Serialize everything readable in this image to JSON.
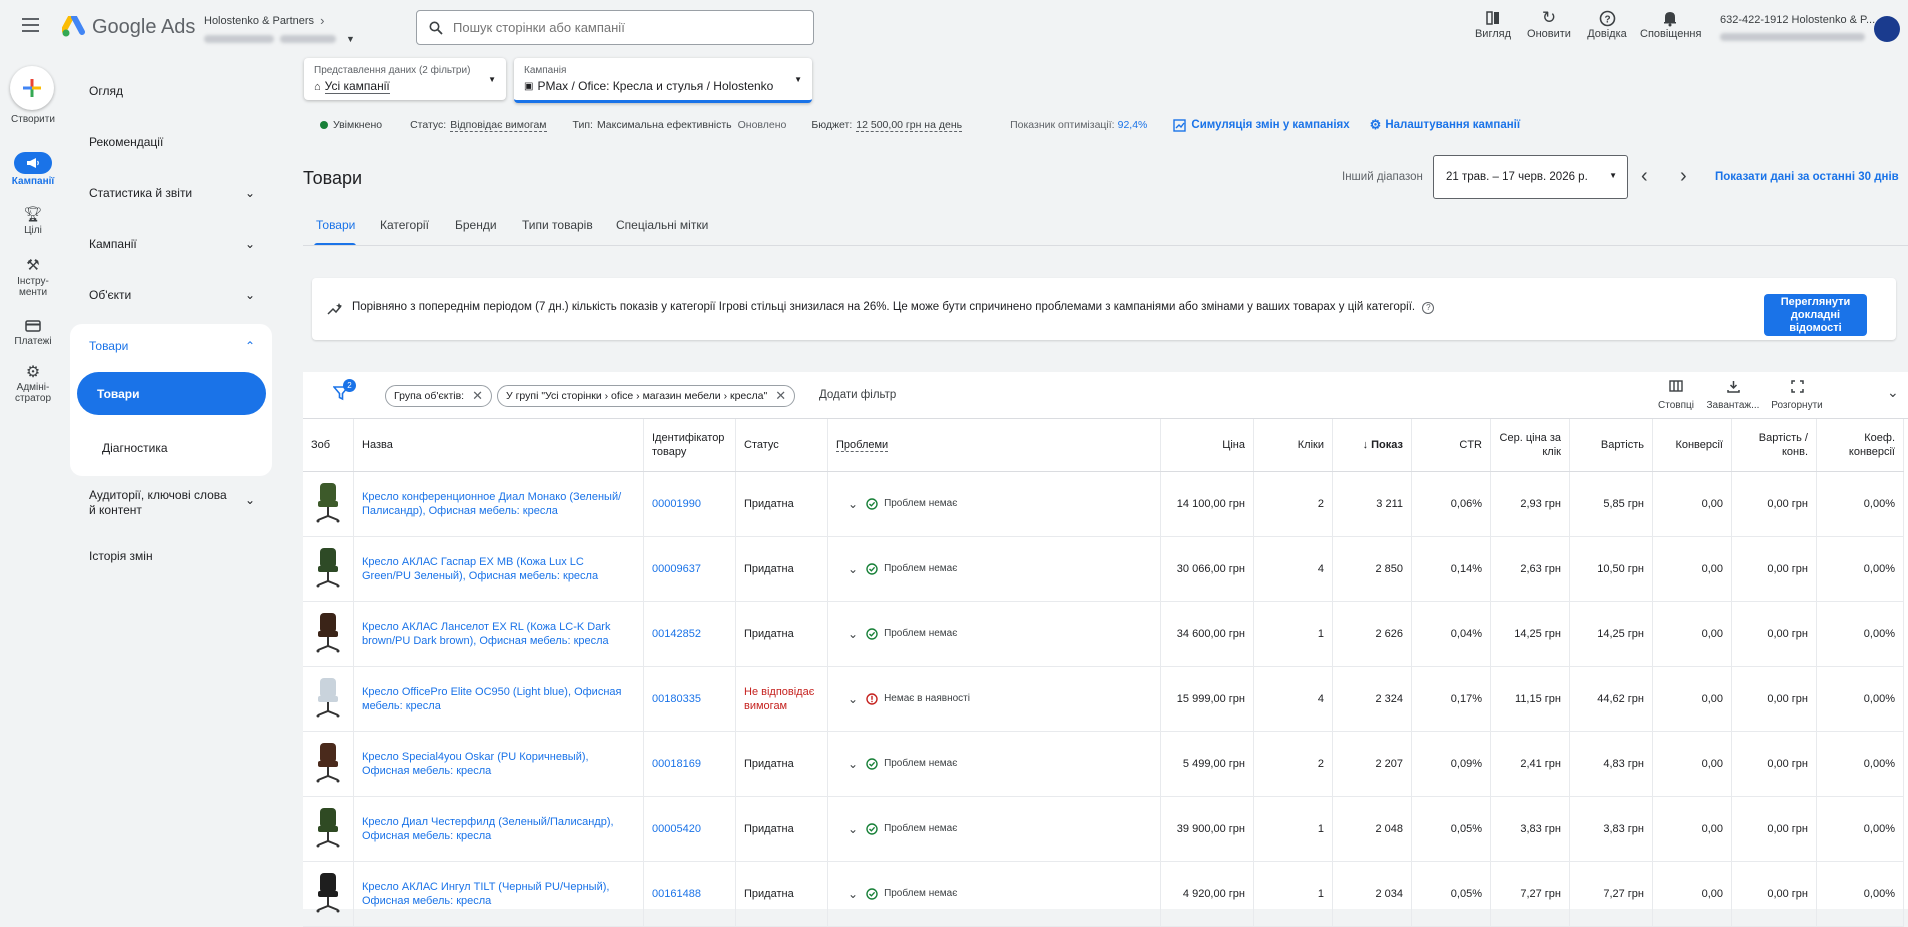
{
  "topbar": {
    "app_name": "Google Ads",
    "account_name": "Holostenko & Partners",
    "search_placeholder": "Пошук сторінки або кампанії",
    "actions": [
      "Вигляд",
      "Оновити",
      "Довідка",
      "Сповіщення"
    ],
    "user_line": "632-422-1912 Holostenko & P..."
  },
  "rail": {
    "items": [
      "Створити",
      "Кампанії",
      "Цілі",
      "Інстру-\nменти",
      "Платежі",
      "Адміні-\nстратор"
    ]
  },
  "sidenav": {
    "items": [
      "Огляд",
      "Рекомендації",
      "Статистика й звіти",
      "Кампанії",
      "Об'єкти",
      "Товари",
      "Товари",
      "Діагностика",
      "Аудиторії, ключові слова й контент",
      "Історія змін"
    ]
  },
  "filters": {
    "view_label": "Представлення даних (2 фільтри)",
    "view_value": "Усі кампанії",
    "campaign_label": "Кампанія",
    "campaign_value": "PMax / Ofice: Кресла и стулья / Holostenko"
  },
  "status_bar": {
    "enabled": "Увімкнено",
    "status_label": "Статус:",
    "status_value": "Відповідає вимогам",
    "type_label": "Тип:",
    "type_value": "Максимальна ефективність",
    "updated": "Оновлено",
    "budget_label": "Бюджет:",
    "budget_value": "12 500,00 грн на день",
    "opt_label": "Показник оптимізації:",
    "opt_value": "92,4%",
    "simulate": "Симуляція змін у кампаніях",
    "settings": "Налаштування кампанії"
  },
  "page": {
    "title": "Товари",
    "range_label": "Інший діапазон",
    "date_range": "21 трав. – 17 черв. 2026 р.",
    "last30": "Показати дані за останні 30 днів"
  },
  "tabs": [
    "Товари",
    "Категорії",
    "Бренди",
    "Типи товарів",
    "Спеціальні мітки"
  ],
  "insight": {
    "text": "Порівняно з попереднім періодом (7 дн.) кількість показів у категорії Ігрові стільці знизилася на 26%. Це може бути спричинено проблемами з кампаніями або змінами у ваших товарах у цій категорії.",
    "button": "Переглянути докладні відомості"
  },
  "filter_bar": {
    "badge": "2",
    "chip1": "Група об'єктів:",
    "chip2": "У групі \"Усі сторінки › ofice › магазин мебели › кресла\"",
    "add_filter": "Додати фільтр",
    "tools": [
      "Стовпці",
      "Завантаж...",
      "Розгорнути"
    ]
  },
  "table": {
    "headers": [
      "Зоб",
      "Назва",
      "Ідентифікатор товару",
      "Статус",
      "Проблеми",
      "Ціна",
      "Кліки",
      "↓ Показ",
      "CTR",
      "Сер. ціна за клік",
      "Вартість",
      "Конверсії",
      "Вартість / конв.",
      "Коеф. конверсії"
    ],
    "rows": [
      {
        "name": "Кресло конференционное Диал Монако (Зеленый/Палисандр), Офисная мебель: кресла",
        "id": "00001990",
        "status": "Придатна",
        "problem": "Проблем немає",
        "ok": true,
        "price": "14 100,00 грн",
        "clicks": "2",
        "impr": "3 211",
        "ctr": "0,06%",
        "cpc": "2,93 грн",
        "cost": "5,85 грн",
        "conv": "0,00",
        "cpconv": "0,00 грн",
        "cr": "0,00%",
        "chair_color": "#3d5a2a"
      },
      {
        "name": "Кресло АКЛАС Гаспар EX MB (Кожа Lux LC Green/PU Зеленый), Офисная мебель: кресла",
        "id": "00009637",
        "status": "Придатна",
        "problem": "Проблем немає",
        "ok": true,
        "price": "30 066,00 грн",
        "clicks": "4",
        "impr": "2 850",
        "ctr": "0,14%",
        "cpc": "2,63 грн",
        "cost": "10,50 грн",
        "conv": "0,00",
        "cpconv": "0,00 грн",
        "cr": "0,00%",
        "chair_color": "#2e4a26"
      },
      {
        "name": "Кресло АКЛАС Ланселот EX RL (Кожа LC-K Dark brown/PU Dark brown), Офисная мебель: кресла",
        "id": "00142852",
        "status": "Придатна",
        "problem": "Проблем немає",
        "ok": true,
        "price": "34 600,00 грн",
        "clicks": "1",
        "impr": "2 626",
        "ctr": "0,04%",
        "cpc": "14,25 грн",
        "cost": "14,25 грн",
        "conv": "0,00",
        "cpconv": "0,00 грн",
        "cr": "0,00%",
        "chair_color": "#3b2418"
      },
      {
        "name": "Кресло OfficePro Elite OC950 (Light blue), Офисная мебель: кресла",
        "id": "00180335",
        "status": "Не відповідає вимогам",
        "problem": "Немає в наявності",
        "ok": false,
        "price": "15 999,00 грн",
        "clicks": "4",
        "impr": "2 324",
        "ctr": "0,17%",
        "cpc": "11,15 грн",
        "cost": "44,62 грн",
        "conv": "0,00",
        "cpconv": "0,00 грн",
        "cr": "0,00%",
        "chair_color": "#c9d3dc"
      },
      {
        "name": "Кресло Special4you Oskar (PU Коричневый), Офисная мебель: кресла",
        "id": "00018169",
        "status": "Придатна",
        "problem": "Проблем немає",
        "ok": true,
        "price": "5 499,00 грн",
        "clicks": "2",
        "impr": "2 207",
        "ctr": "0,09%",
        "cpc": "2,41 грн",
        "cost": "4,83 грн",
        "conv": "0,00",
        "cpconv": "0,00 грн",
        "cr": "0,00%",
        "chair_color": "#4a2a1c"
      },
      {
        "name": "Кресло Диал Честерфилд (Зеленый/Палисандр), Офисная мебель: кресла",
        "id": "00005420",
        "status": "Придатна",
        "problem": "Проблем немає",
        "ok": true,
        "price": "39 900,00 грн",
        "clicks": "1",
        "impr": "2 048",
        "ctr": "0,05%",
        "cpc": "3,83 грн",
        "cost": "3,83 грн",
        "conv": "0,00",
        "cpconv": "0,00 грн",
        "cr": "0,00%",
        "chair_color": "#2f4a23"
      },
      {
        "name": "Кресло АКЛАС Ингул TILT (Черный PU/Черный), Офисная мебель: кресла",
        "id": "00161488",
        "status": "Придатна",
        "problem": "Проблем немає",
        "ok": true,
        "price": "4 920,00 грн",
        "clicks": "1",
        "impr": "2 034",
        "ctr": "0,05%",
        "cpc": "7,27 грн",
        "cost": "7,27 грн",
        "conv": "0,00",
        "cpconv": "0,00 грн",
        "cr": "0,00%",
        "chair_color": "#1e1e1e"
      }
    ]
  }
}
